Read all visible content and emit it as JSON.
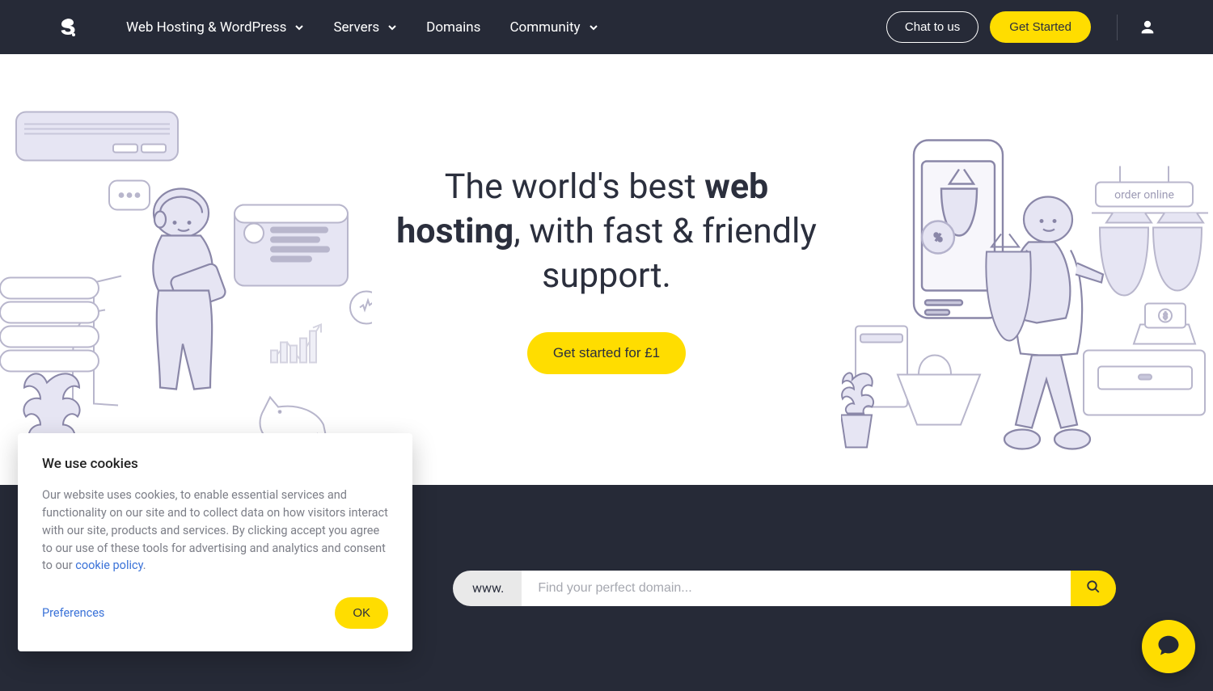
{
  "nav": {
    "items": [
      {
        "label": "Web Hosting & WordPress",
        "has_submenu": true
      },
      {
        "label": "Servers",
        "has_submenu": true
      },
      {
        "label": "Domains",
        "has_submenu": false
      },
      {
        "label": "Community",
        "has_submenu": true
      }
    ],
    "chat_label": "Chat to us",
    "cta_label": "Get Started"
  },
  "hero": {
    "title_pre": "The world's best ",
    "title_bold": "web hosting",
    "title_post": ", with fast & friendly support.",
    "cta_label": "Get started for £1"
  },
  "illustration_text": {
    "order_online": "order online"
  },
  "domain_search": {
    "prefix": "www.",
    "placeholder": "Find your perfect domain..."
  },
  "cookie": {
    "heading": "We use cookies",
    "body": "Our website uses cookies, to enable essential services and functionality on our site and to collect data on how visitors interact with our site, products and services. By clicking accept you agree to our use of these tools for advertising and analytics and consent to our ",
    "policy_link": "cookie policy",
    "body_tail": ".",
    "preferences": "Preferences",
    "ok": "OK"
  },
  "colors": {
    "accent": "#ffdd00",
    "dark": "#262a37",
    "link": "#3a72d8"
  }
}
